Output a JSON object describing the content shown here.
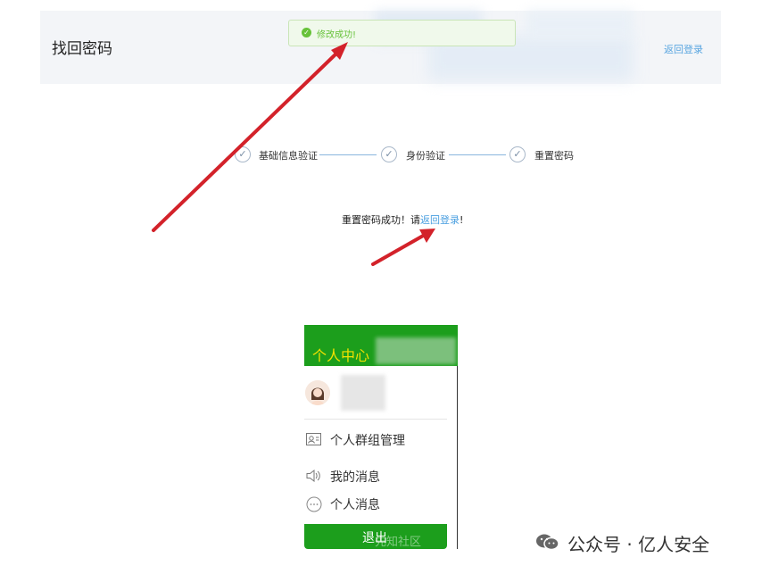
{
  "header": {
    "title": "找回密码",
    "back_link": "返回登录"
  },
  "toast": {
    "icon": "check-circle-icon",
    "message": "修改成功!"
  },
  "steps": [
    {
      "label": "基础信息验证",
      "icon": "check-icon"
    },
    {
      "label": "身份验证",
      "icon": "check-icon"
    },
    {
      "label": "重置密码",
      "icon": "check-icon"
    }
  ],
  "reset_message": {
    "prefix": "重置密码成功！请",
    "link": "返回登录",
    "suffix": "!"
  },
  "panel": {
    "title": "个人中心",
    "menu": [
      {
        "icon": "id-card-icon",
        "label": "个人群组管理"
      },
      {
        "icon": "speaker-icon",
        "label": "我的消息"
      },
      {
        "icon": "chat-bubble-icon",
        "label": "个人消息"
      }
    ],
    "logout": "退出",
    "logout_watermark": "先知社区"
  },
  "watermark": {
    "text": "公众号 · 亿人安全",
    "icon": "wechat-icon"
  },
  "colors": {
    "panel_green": "#1c9e1c",
    "panel_title": "#f2e100",
    "link_blue": "#4a9fe0",
    "toast_green": "#67c23a",
    "arrow_red": "#d3222a"
  }
}
